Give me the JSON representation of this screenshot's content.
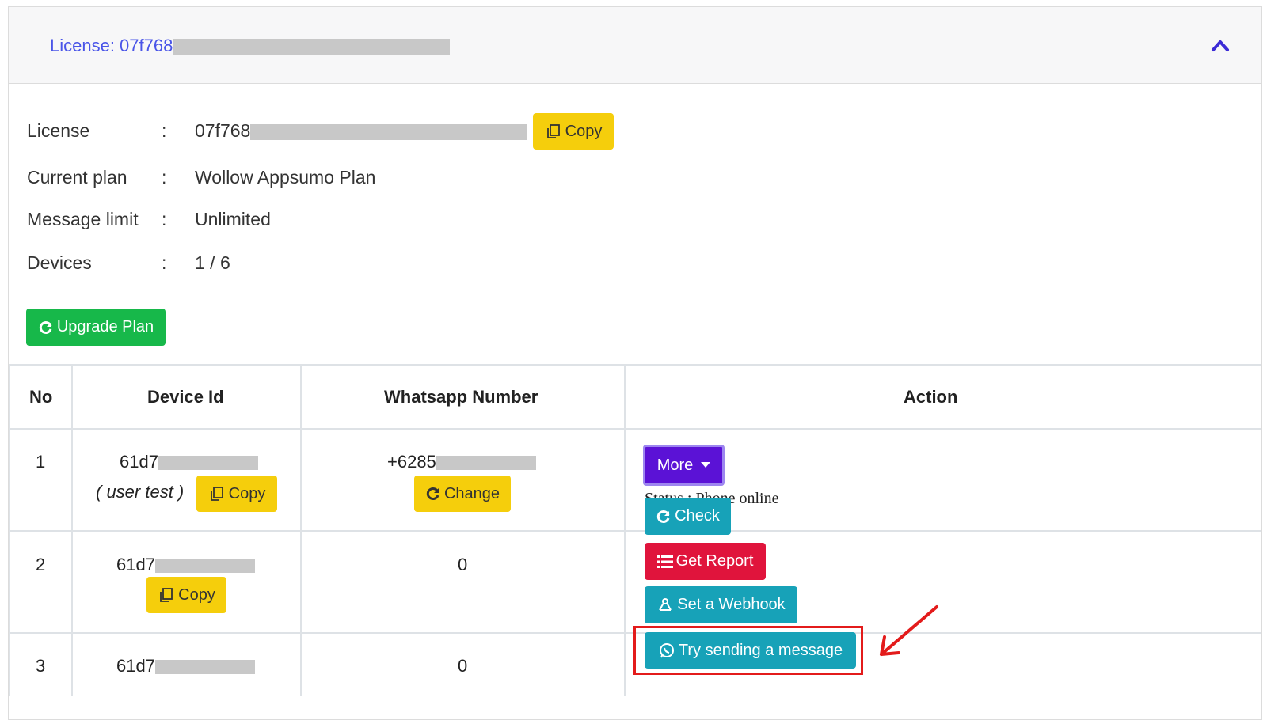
{
  "header": {
    "license_label": "License: 07f768"
  },
  "info": {
    "license_label": "License",
    "license_value": "07f768",
    "plan_label": "Current plan",
    "plan_value": "Wollow Appsumo Plan",
    "limit_label": "Message limit",
    "limit_value": "Unlimited",
    "devices_label": "Devices",
    "devices_value": "1 / 6",
    "colon": ":",
    "copy_label": "Copy",
    "upgrade_label": "Upgrade Plan"
  },
  "table": {
    "headers": [
      "No",
      "Device Id",
      "Whatsapp Number",
      "Action"
    ],
    "rows": [
      {
        "no": "1",
        "device_id": "61d7",
        "device_note": "( user test )",
        "number": "+6285",
        "copy_label": "Copy",
        "change_label": "Change"
      },
      {
        "no": "2",
        "device_id": "61d7",
        "number": "0",
        "copy_label": "Copy"
      },
      {
        "no": "3",
        "device_id": "61d7",
        "number": "0"
      }
    ]
  },
  "actions": {
    "more_label": "More",
    "status_text": "Status : Phone online",
    "check_label": "Check",
    "report_label": "Get Report",
    "webhook_label": "Set a Webhook",
    "send_label": "Try sending a message"
  },
  "icons": [
    "copy-icon",
    "refresh-icon",
    "chevron-up-icon",
    "caret-down-icon",
    "list-icon",
    "webhook-icon",
    "whatsapp-icon",
    "arrow-annotation"
  ],
  "colors": {
    "accent": "#4a55e8",
    "yellow": "#f5ce0c",
    "green": "#17b84a",
    "purple": "#5b12d6",
    "teal": "#17a2b8",
    "red": "#e0143c"
  }
}
